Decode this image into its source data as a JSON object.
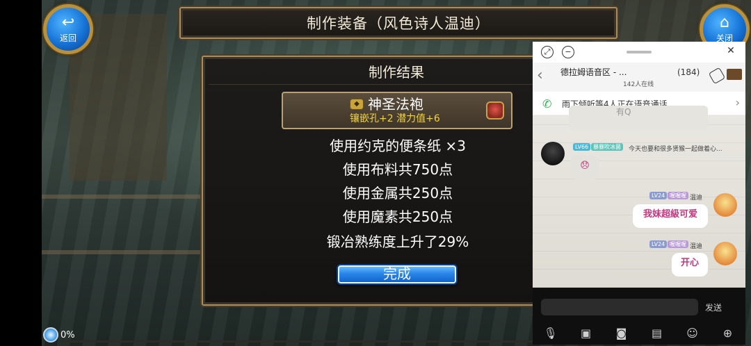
{
  "title": "制作装备（风色诗人温迪）",
  "buttons": {
    "back": "返回",
    "close": "关闭"
  },
  "result_panel": {
    "header": "制作结果",
    "item": {
      "name": "神圣法袍",
      "stats": "镶嵌孔+2 潜力值+6"
    },
    "lines": [
      "使用约克的便条纸 ×3",
      "使用布料共750点",
      "使用金属共250点",
      "使用魔素共250点",
      "锻冶熟练度上升了29%"
    ],
    "done_label": "完成"
  },
  "status": {
    "percent": "0%"
  },
  "chat": {
    "group_name": "德拉姆语音区 - ...",
    "group_count": "(184)",
    "online": "142人在线",
    "voice_notice": "雨下倾听等4人正在语音通话",
    "prev_message_fragment": "有Q",
    "messages": [
      {
        "level": "LV66",
        "tag": "暴暴吹冰菌",
        "nick": "今天也要和很多贤猴一起做着心...",
        "side": "left",
        "content": "😞"
      },
      {
        "level": "LV24",
        "tag": "喔喔喔",
        "nick": "温迪",
        "side": "right",
        "content": "我妹超級可爱"
      },
      {
        "level": "LV24",
        "tag": "喔喔喔",
        "nick": "温迪",
        "side": "right",
        "content": "开心"
      }
    ],
    "send_label": "发送"
  }
}
